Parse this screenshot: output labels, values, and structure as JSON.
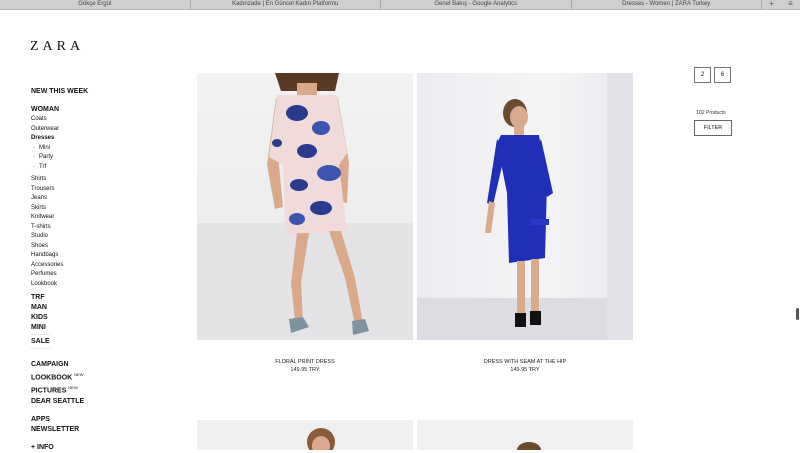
{
  "tabs": [
    "Gökçe Ergül",
    "Kadınzade | En Güncel Kadın Platformu",
    "Genel Bakış - Google Analytics",
    "Dresses - Women | ZARA Turkey"
  ],
  "tab_tools": [
    "+",
    "≡"
  ],
  "logo": "ZARA",
  "nav": {
    "new_this_week": "NEW THIS WEEK",
    "woman": "WOMAN",
    "woman_items_a": [
      "Coats",
      "Outerwear"
    ],
    "dresses": "Dresses",
    "dresses_sub": [
      "Mini",
      "Party",
      "Trf"
    ],
    "woman_items_b": [
      "Shirts",
      "Trousers",
      "Jeans",
      "Skirts",
      "Knitwear",
      "T-shirts",
      "Studio",
      "Shoes",
      "Handbags",
      "Accessories",
      "Perfumes",
      "Lookbook"
    ],
    "trf": "TRF",
    "man": "MAN",
    "kids": "KIDS",
    "mini": "MINI",
    "dots": "·······",
    "sale": "SALE",
    "campaign": "CAMPAIGN",
    "lookbook": "LOOKBOOK",
    "lookbook_badge": "NEW",
    "pictures": "PICTURES",
    "pictures_badge": "NEW",
    "dear_seattle": "DEAR SEATTLE",
    "apps": "APPS",
    "newsletter": "NEWSLETTER",
    "info": "+ INFO"
  },
  "view_options": [
    "2",
    "6"
  ],
  "product_count": "102 Products",
  "filter_label": "FILTER",
  "products": [
    {
      "name": "FLORAL PRINT DRESS",
      "price": "149.95 TRY"
    },
    {
      "name": "DRESS WITH SEAM AT THE HIP",
      "price": "149.95 TRY"
    }
  ],
  "colors": {
    "dress_blue": "#1f2fb8",
    "floral_pink": "#f1dada",
    "floral_navy": "#2a3a8c"
  }
}
